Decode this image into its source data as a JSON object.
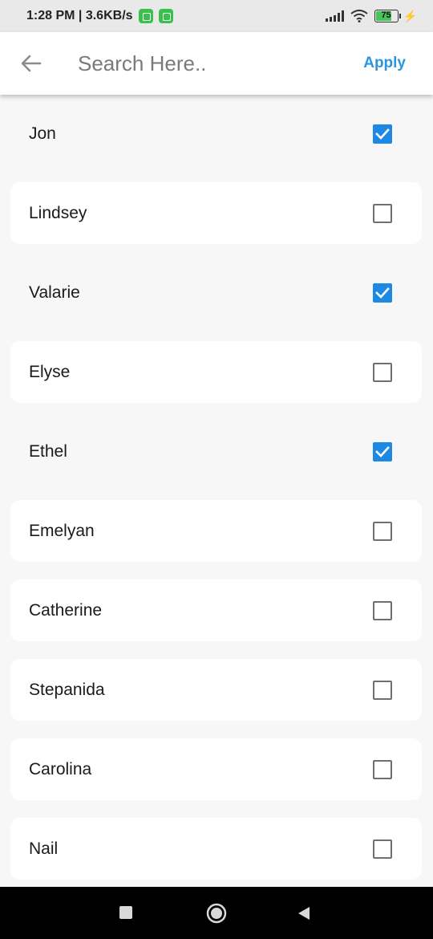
{
  "status_bar": {
    "time_speed": "1:28 PM | 3.6KB/s",
    "battery_level": "75",
    "icons": [
      "app-notification-icon",
      "app-notification-icon",
      "signal-icon",
      "wifi-icon",
      "battery-icon",
      "charging-icon"
    ]
  },
  "app_bar": {
    "back_icon": "arrow-left-icon",
    "search_placeholder": "Search Here..",
    "search_value": "",
    "apply_label": "Apply",
    "accent_color": "#2b95e0"
  },
  "items": [
    {
      "label": "Jon",
      "checked": true
    },
    {
      "label": "Lindsey",
      "checked": false
    },
    {
      "label": "Valarie",
      "checked": true
    },
    {
      "label": "Elyse",
      "checked": false
    },
    {
      "label": "Ethel",
      "checked": true
    },
    {
      "label": "Emelyan",
      "checked": false
    },
    {
      "label": "Catherine",
      "checked": false
    },
    {
      "label": "Stepanida",
      "checked": false
    },
    {
      "label": "Carolina",
      "checked": false
    },
    {
      "label": "Nail",
      "checked": false
    }
  ],
  "colors": {
    "checkbox_checked": "#1e88e5",
    "checkbox_unchecked_border": "#6f6f6f",
    "card_background": "#ffffff",
    "page_background": "#f7f7f7"
  },
  "nav_bar": {
    "buttons": [
      "recents-icon",
      "home-icon",
      "back-triangle-icon"
    ]
  }
}
